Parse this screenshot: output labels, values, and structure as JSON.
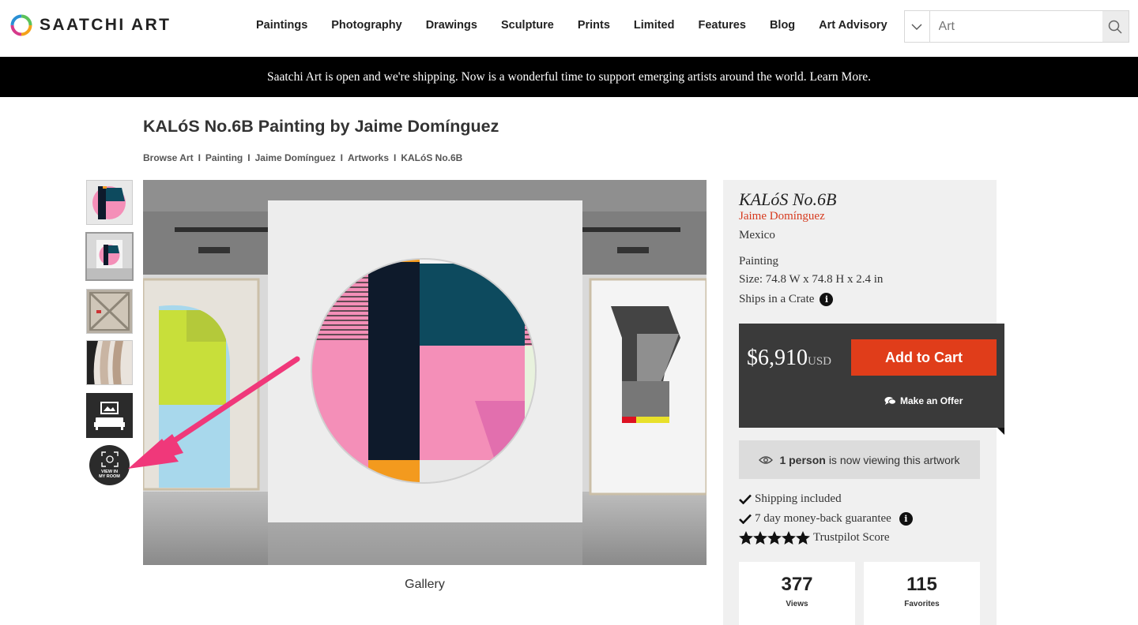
{
  "header": {
    "logo_text": "SAATCHI ART",
    "nav": [
      "Paintings",
      "Photography",
      "Drawings",
      "Sculpture",
      "Prints",
      "Limited",
      "Features",
      "Blog",
      "Art Advisory"
    ],
    "search_placeholder": "Art"
  },
  "banner": {
    "text": "Saatchi Art is open and we're shipping. Now is a wonderful time to support emerging artists around the world. Learn More."
  },
  "page": {
    "title": "KALóS No.6B Painting by Jaime Domínguez",
    "breadcrumb": [
      "Browse Art",
      "Painting",
      "Jaime Domínguez",
      "Artworks",
      "KALóS No.6B"
    ],
    "breadcrumb_sep": "I"
  },
  "gallery": {
    "view_in_room": [
      "VIEW IN",
      "MY ROOM"
    ],
    "caption": "Gallery"
  },
  "artwork": {
    "title": "KALóS No.6B",
    "artist": "Jaime Domínguez",
    "country": "Mexico",
    "medium": "Painting",
    "size": "Size: 74.8 W x 74.8 H x 2.4 in",
    "shipping": "Ships in a Crate",
    "info_glyph": "i"
  },
  "purchase": {
    "price": "$6,910",
    "currency": "USD",
    "add_to_cart": "Add to Cart",
    "make_offer": "Make an Offer"
  },
  "viewing": {
    "count": "1 person",
    "text": "is now viewing this artwork"
  },
  "features": {
    "shipping_included": "Shipping included",
    "guarantee": "7 day money-back guarantee",
    "trustpilot": "Trustpilot Score",
    "stars": 5
  },
  "stats": {
    "views_value": "377",
    "views_label": "Views",
    "favorites_value": "115",
    "favorites_label": "Favorites"
  },
  "colors": {
    "accent": "#e03d1a",
    "artist_link": "#d63a1e",
    "arrow": "#f0387a",
    "price_box": "#3a3a3a"
  }
}
